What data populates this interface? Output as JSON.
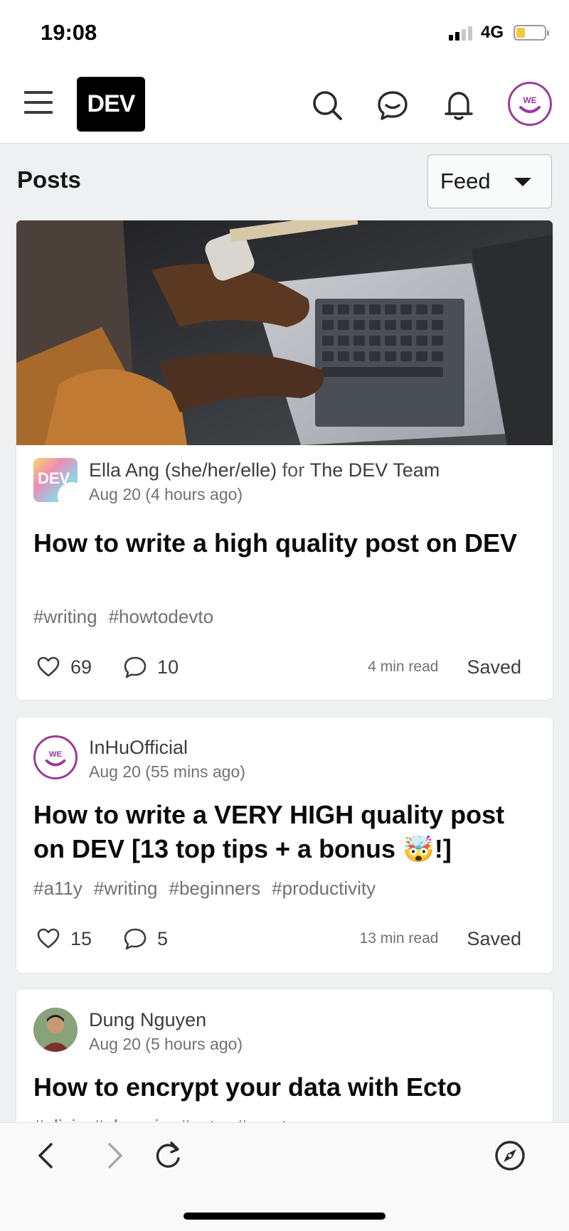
{
  "status": {
    "time": "19:08",
    "network": "4G"
  },
  "nav": {
    "logo": "DEV",
    "avatar_text": "WE",
    "icons": [
      "hamburger-icon",
      "search-icon",
      "chat-icon",
      "bell-icon"
    ]
  },
  "posts_header": {
    "title": "Posts",
    "feed_select": "Feed"
  },
  "posts": [
    {
      "org_avatar_text": "DEV",
      "author": "Ella Ang (she/her/elle)",
      "for_text": "for",
      "org": "The DEV Team",
      "date": "Aug 20 (4 hours ago)",
      "title": "How to write a high quality post on DEV",
      "tags": [
        "#writing",
        "#howtodevto"
      ],
      "reactions": "69",
      "comments": "10",
      "read_time": "4 min read",
      "saved": "Saved"
    },
    {
      "avatar_text": "WE",
      "author": "InHuOfficial",
      "date": "Aug 20 (55 mins ago)",
      "title": "How to write a VERY HIGH quality post on DEV [13 top tips + a bonus 🤯!]",
      "tags": [
        "#a11y",
        "#writing",
        "#beginners",
        "#productivity"
      ],
      "reactions": "15",
      "comments": "5",
      "read_time": "13 min read",
      "saved": "Saved"
    },
    {
      "author": "Dung Nguyen",
      "date": "Aug 20 (5 hours ago)",
      "title": "How to encrypt your data with Ecto",
      "tags": [
        "#elixir",
        "#phoenix",
        "#ecto",
        "#crypto"
      ]
    }
  ],
  "browser": {
    "icons": [
      "back-icon",
      "forward-icon",
      "reload-icon",
      "compass-icon"
    ]
  }
}
